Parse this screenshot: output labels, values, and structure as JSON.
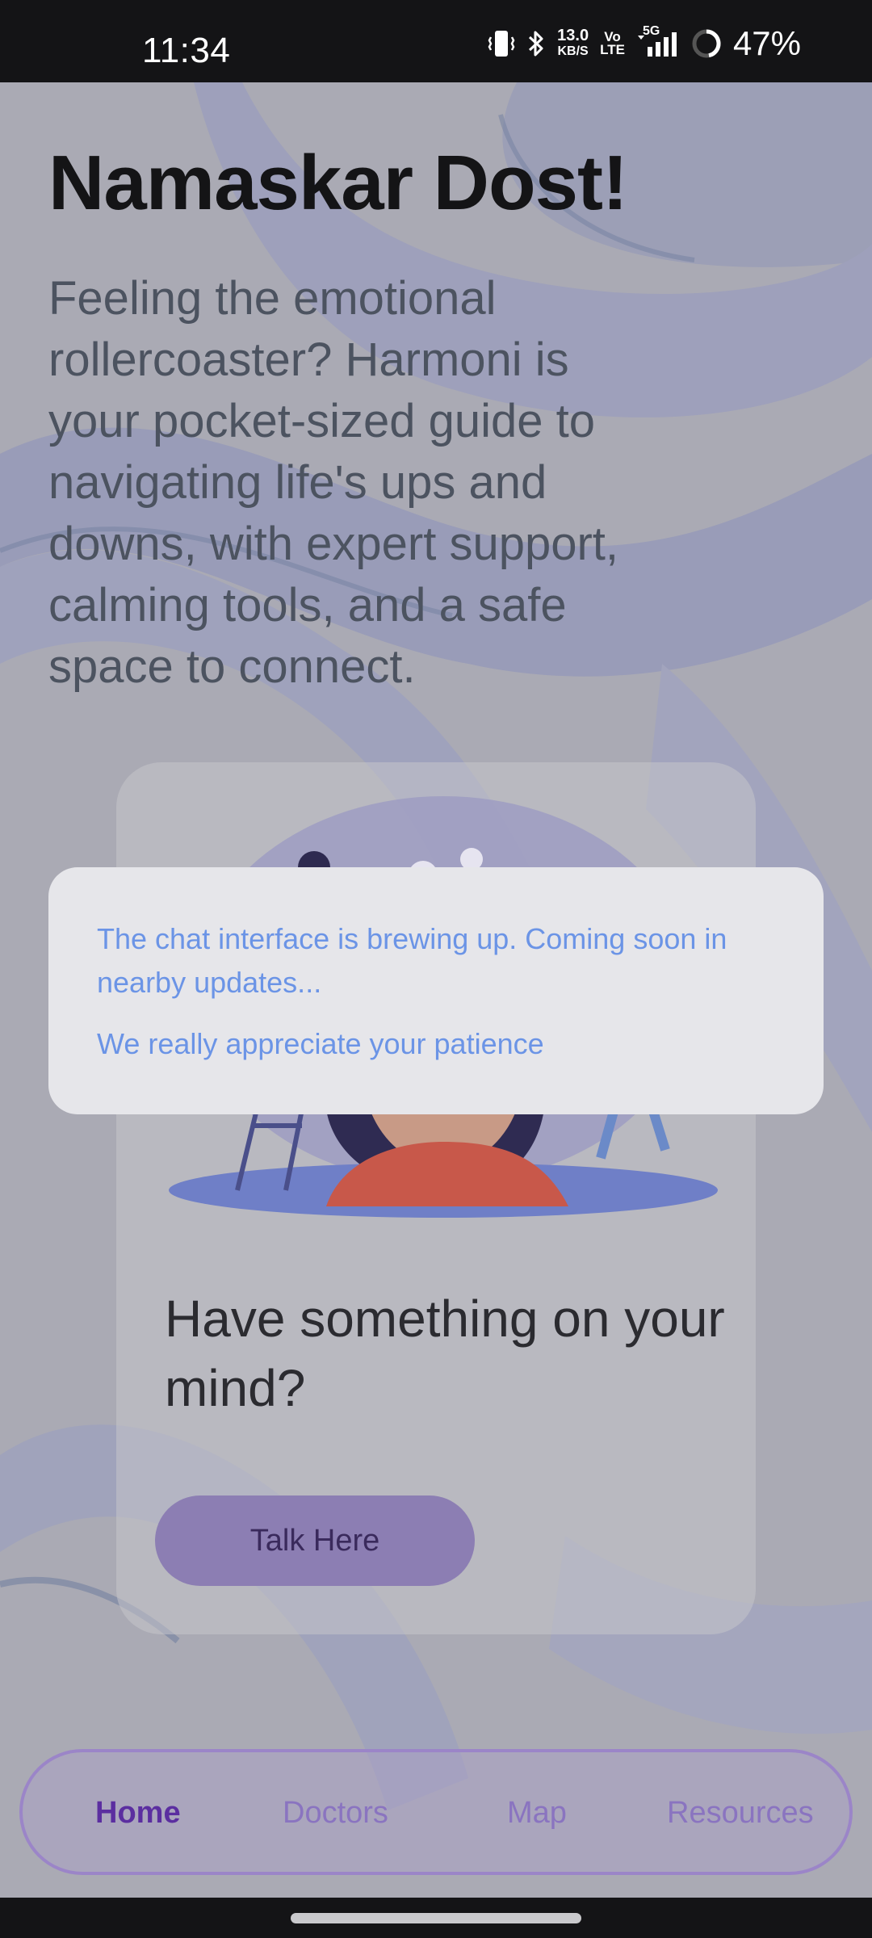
{
  "status_bar": {
    "time": "11:34",
    "net_speed_value": "13.0",
    "net_speed_unit": "KB/S",
    "volte_top": "Vo",
    "volte_bottom": "LTE",
    "network": "5G",
    "battery": "47%",
    "icons": [
      "vibrate-icon",
      "bluetooth-icon",
      "signal-icon",
      "battery-ring-icon"
    ]
  },
  "main": {
    "greeting": "Namaskar Dost!",
    "intro": "Feeling the emotional rollercoaster? Harmoni is your pocket-sized guide to navigating life's ups and downs, with expert support, calming tools, and a safe space to connect.",
    "card": {
      "question": "Have something on your mind?",
      "button_label": "Talk Here"
    }
  },
  "dialog": {
    "message": "The chat interface is brewing up. Coming soon in nearby updates...",
    "thanks": "We really appreciate your patience",
    "text_color": "#6b94e6"
  },
  "bottom_nav": {
    "items": [
      {
        "label": "Home",
        "active": true
      },
      {
        "label": "Doctors",
        "active": false
      },
      {
        "label": "Map",
        "active": false
      },
      {
        "label": "Resources",
        "active": false
      }
    ],
    "active_color": "#5b2ea0",
    "inactive_color": "#8a74c0"
  }
}
